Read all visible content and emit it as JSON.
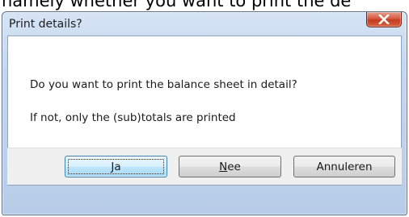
{
  "background": {
    "clipped_text": "namely whether you want to print the de"
  },
  "window": {
    "title": "Print details?",
    "close_icon": "close-x-icon"
  },
  "message": {
    "line1": "Do you want to print the balance sheet in detail?",
    "line2": "If not, only the (sub)totals are printed"
  },
  "buttons": {
    "yes": {
      "mnemonic": "J",
      "rest": "a"
    },
    "no": {
      "mnemonic": "N",
      "rest": "ee"
    },
    "cancel": {
      "label": "Annuleren"
    }
  },
  "colors": {
    "close_button": "#c23b1f",
    "default_button_border": "#3c7fb1",
    "frame": "#b7cce8"
  }
}
